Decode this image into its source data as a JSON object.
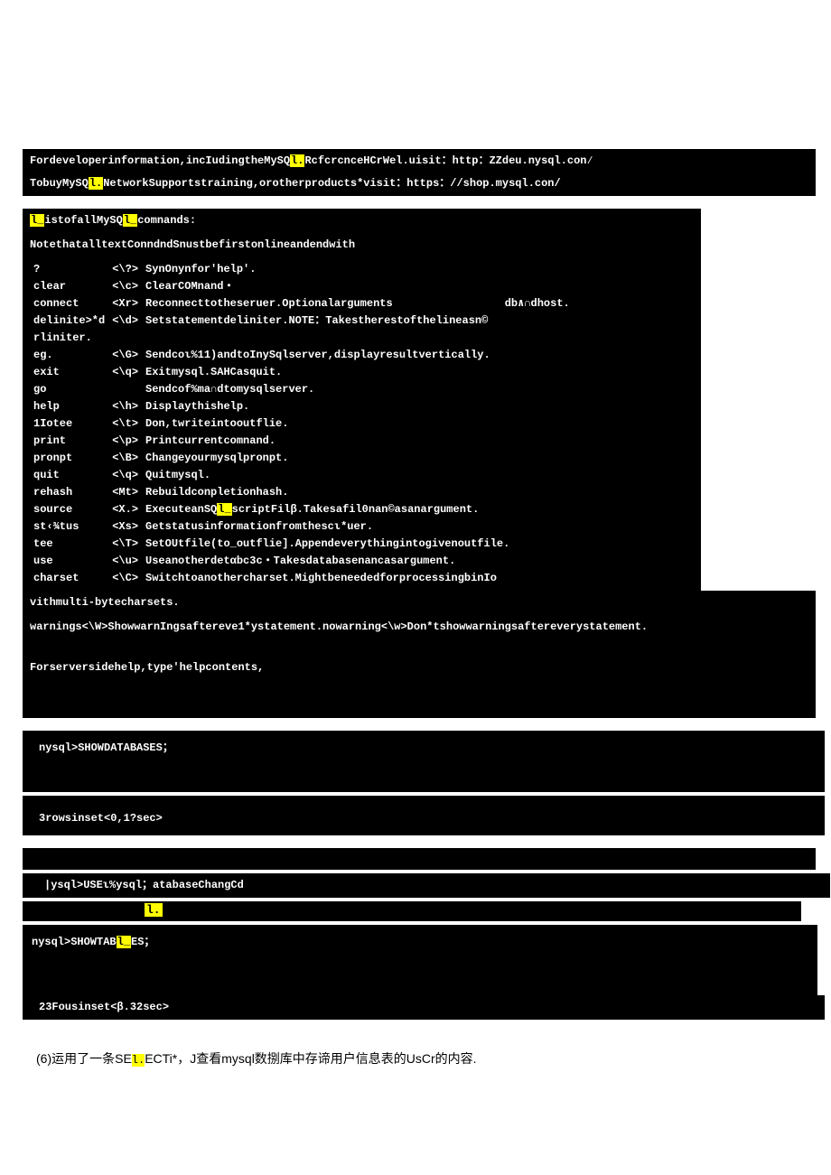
{
  "intro": {
    "line1_a": "Fordeveloperinformation,incIudingtheMySQ",
    "line1_hl": "l.",
    "line1_b": "RcfcrcnceHCrWel.uisit：http：ZZdeu.nysql.con∕",
    "line2_a": "TobuyMySQ",
    "line2_hl": "l.",
    "line2_b": "NetworkSupportstraining,orotherproducts*visit：https：//shop.mysql.con/"
  },
  "hdr": {
    "a_hl": "l_",
    "a_txt": "istofallMySQ",
    "a_hl2": "l_",
    "a_end": "comnands:",
    "note": "NotethatalltextConndndSnustbefirstonlineandendwith"
  },
  "rows": [
    {
      "c": "?",
      "k": "<\\?>",
      "d": "SynOnynfor'help'."
    },
    {
      "c": "clear",
      "k": "<\\c>",
      "d": "ClearCOMnand・"
    },
    {
      "c": "connect",
      "k": "<Xr>",
      "d": "Reconnecttotheseruer.Optionalarguments",
      "d2": "db∧∩dhost."
    },
    {
      "c": "delinite>*d",
      "k": "<\\d>",
      "d": "Setstatementdeliniter.NOTE：Takestherestofthelineasn©"
    },
    {
      "c": "rliniter.",
      "k": "",
      "d": ""
    },
    {
      "c": "eg.",
      "k": "<\\G>",
      "d": "Sendcoι%11)andtoInySqlserver,displayresultvertically."
    },
    {
      "c": "exit",
      "k": "<\\q>",
      "d": "Exitmysql.SAHCasquit."
    },
    {
      "c": "go",
      "k": "",
      "d": "Sendcof%ma∩dtomysqlserver."
    },
    {
      "c": "help",
      "k": "<\\h>",
      "d": "Displaythishelp."
    },
    {
      "c": "1Iotee",
      "k": "<\\t>",
      "d": "Don,twriteintooutflie."
    },
    {
      "c": "print",
      "k": "<\\p>",
      "d": "Printcurrentcomnand."
    },
    {
      "c": "pronpt",
      "k": "<\\B>",
      "d": "Changeyourmysqlpronpt."
    },
    {
      "c": "quit",
      "k": "<\\q>",
      "d": "Quitmysql."
    },
    {
      "c": "rehash",
      "k": "<Mt>",
      "d": "Rebuildconpletionhash."
    },
    {
      "c": "source",
      "k": "<X.>",
      "d": "ExecuteanSQl_scriptFilβ.Takesafil0nan©asanargument.",
      "hl": "l_",
      "pre": "ExecuteanSQ",
      "post": "scriptFilβ.Takesafil0nan©asanargument."
    },
    {
      "c": "st‹¾tus",
      "k": "<Xs>",
      "d": "Getstatusinformationfromthescι*uer."
    },
    {
      "c": "tee",
      "k": "<\\T>",
      "d": "SetOUtfile(to_outflie].Appendeverythingintogivenoutfile."
    },
    {
      "c": "use",
      "k": "<\\u>",
      "d": "Useanotherdetαbc3c・Takesdatabasenancasargument."
    },
    {
      "c": "charset",
      "k": "<\\C>",
      "d": "Switchtoanothercharset.MightbeneededforprocessingbinIo"
    }
  ],
  "tail": {
    "t1": "vithmulti-bytecharsets.",
    "t2": "warnings<\\W>ShowwarnIngsaftereve1*ystatement.nowarning<\\w>Don*tshowwarningsaftereverystatement.",
    "t3": "Forserversidehelp,type'helpcontents,"
  },
  "blocks": {
    "b1_cmd": "nysql>SHOWDATABASES；",
    "b1_res": "3rowsinset<0,1?sec>",
    "b2": "|ysql>USEι%ysql；atabaseChangCd",
    "b3_hl": "l.",
    "b4_a": "nysql>SHOWTAB",
    "b4_hl": "l_",
    "b4_b": "ES；",
    "b4_res": "23Fousinset<β.32sec>"
  },
  "caption": {
    "pre": "(6)运用了一条SE",
    "hl": "l.",
    "post": "ECTi*，J查看mysql数捌库中存谛用户信息表的UsCr的内容."
  }
}
